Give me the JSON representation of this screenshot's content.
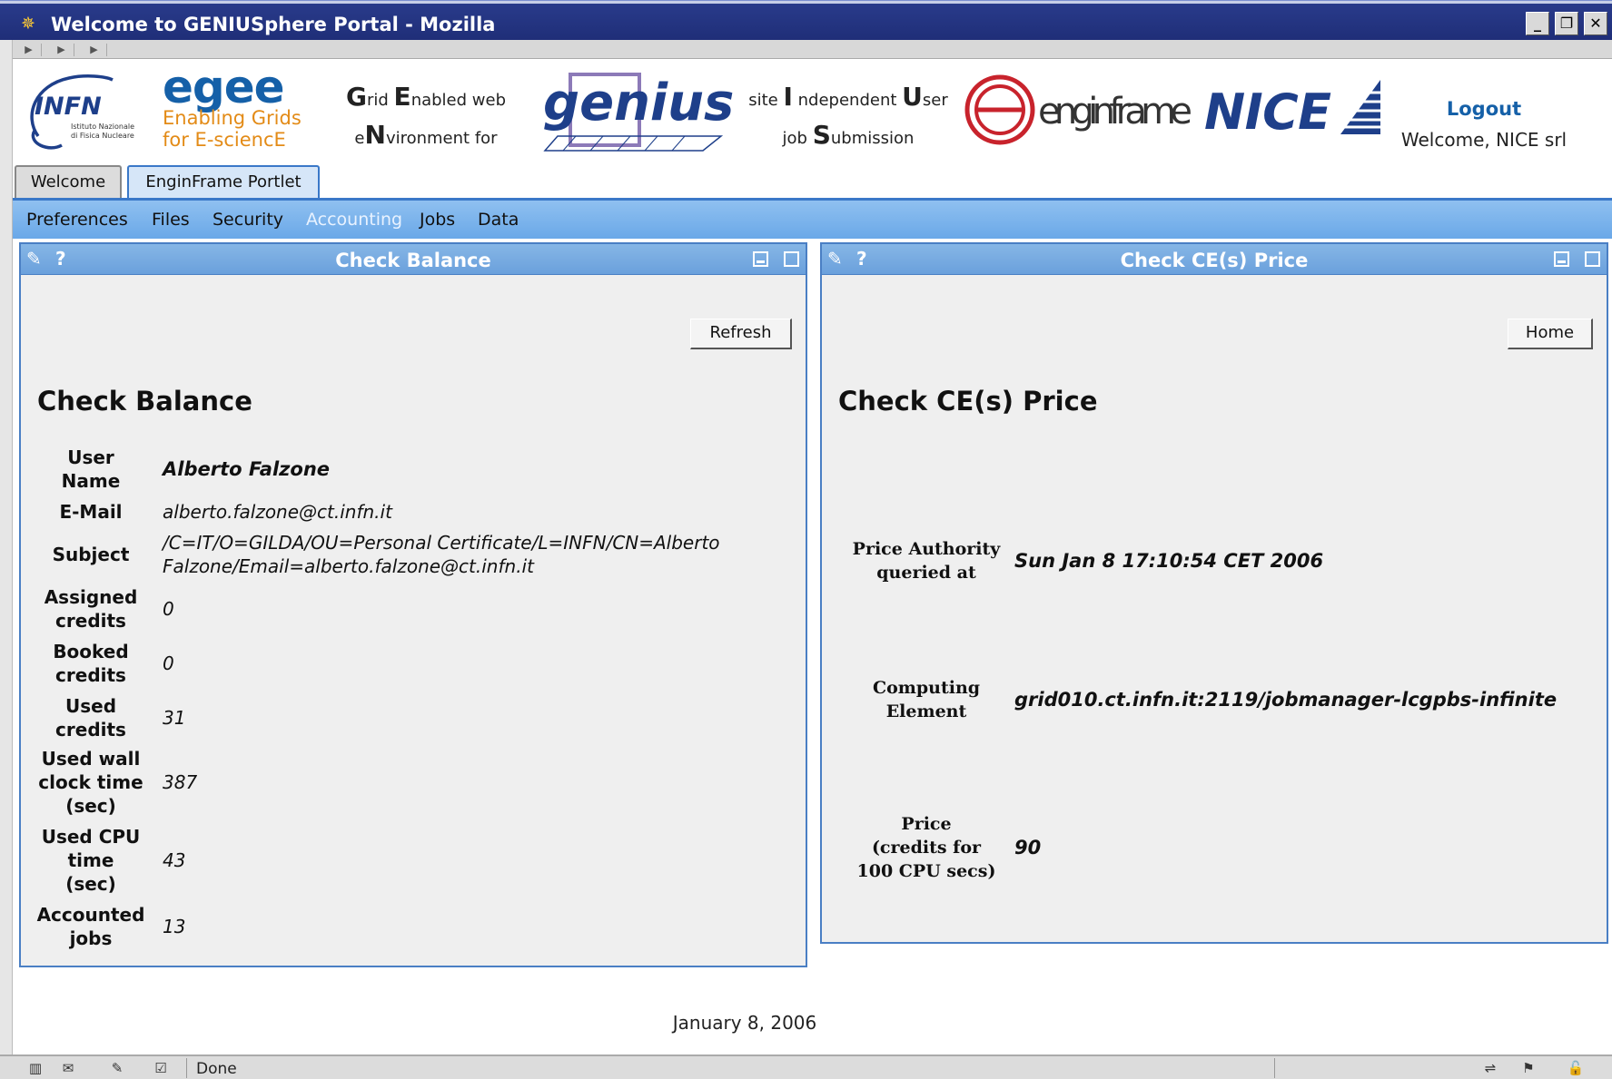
{
  "window": {
    "title": "Welcome to GENIUSphere Portal - Mozilla",
    "btn_minimize": "_",
    "btn_restore": "❐",
    "btn_close": "✕"
  },
  "banner": {
    "infn_text": "INFN",
    "infn_sub1": "Istituto Nazionale",
    "infn_sub2": "di Fisica Nucleare",
    "egee_logo": "egee",
    "egee_line1": "Enabling Grids",
    "egee_line2": "for E-sciencE",
    "grid_line1_a": "G",
    "grid_line1_b": "rid ",
    "grid_line1_c": "E",
    "grid_line1_d": "nabled web",
    "grid_line2_a": "e",
    "grid_line2_b": "N",
    "grid_line2_c": "vironment for",
    "genius_logo": "genius",
    "site_line1_a": "site ",
    "site_line1_b": "I",
    "site_line1_c": " ndependent ",
    "site_line1_d": "U",
    "site_line1_e": "ser",
    "site_line2_a": "job ",
    "site_line2_b": "S",
    "site_line2_c": "ubmission",
    "enginframe_logo": "enginframe",
    "nice_logo": "NICE",
    "logout": "Logout",
    "welcome_user": "Welcome, NICE srl"
  },
  "tabs": [
    {
      "label": "Welcome"
    },
    {
      "label": "EnginFrame Portlet"
    }
  ],
  "menu": [
    {
      "label": "Preferences"
    },
    {
      "label": "Files"
    },
    {
      "label": "Security"
    },
    {
      "label": "Accounting"
    },
    {
      "label": "Jobs"
    },
    {
      "label": "Data"
    }
  ],
  "balance": {
    "title": "Check Balance",
    "heading": "Check Balance",
    "refresh": "Refresh",
    "rows": [
      {
        "label_l1": "User",
        "label_l2": "Name",
        "label_l3": "",
        "value": "Alberto Falzone"
      },
      {
        "label_l1": "E-Mail",
        "label_l2": "",
        "label_l3": "",
        "value": "alberto.falzone@ct.infn.it"
      },
      {
        "label_l1": "Subject",
        "label_l2": "",
        "label_l3": "",
        "value": "/C=IT/O=GILDA/OU=Personal Certificate/L=INFN/CN=Alberto",
        "value_l2": "Falzone/Email=alberto.falzone@ct.infn.it"
      },
      {
        "label_l1": "Assigned",
        "label_l2": "credits",
        "label_l3": "",
        "value": "0"
      },
      {
        "label_l1": "Booked",
        "label_l2": "credits",
        "label_l3": "",
        "value": "0"
      },
      {
        "label_l1": "Used",
        "label_l2": "credits",
        "label_l3": "",
        "value": "31"
      },
      {
        "label_l1": "Used wall",
        "label_l2": "clock time",
        "label_l3": "(sec)",
        "value": "387"
      },
      {
        "label_l1": "Used CPU",
        "label_l2": "time",
        "label_l3": "(sec)",
        "value": "43"
      },
      {
        "label_l1": "Accounted",
        "label_l2": "jobs",
        "label_l3": "",
        "value": "13"
      }
    ]
  },
  "price": {
    "title": "Check CE(s) Price",
    "heading": "Check CE(s) Price",
    "home": "Home",
    "rows": [
      {
        "label_l1": "Price Authority",
        "label_l2": "queried at",
        "label_l3": "",
        "value": "Sun Jan 8 17:10:54 CET 2006"
      },
      {
        "label_l1": "Computing",
        "label_l2": "Element",
        "label_l3": "",
        "value": "grid010.ct.infn.it:2119/jobmanager-lcgpbs-infinite"
      },
      {
        "label_l1": "Price",
        "label_l2": "(credits for",
        "label_l3": "100 CPU secs)",
        "value": "90"
      }
    ]
  },
  "footer": {
    "date": "January 8, 2006"
  },
  "statusbar": {
    "text": "Done"
  },
  "colors": {
    "titlebar": "#1f2e78",
    "menubar": "#6aa8e8",
    "portlet_border": "#4a7fc4",
    "link": "#1560a8"
  }
}
